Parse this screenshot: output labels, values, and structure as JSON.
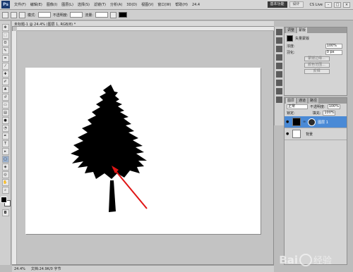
{
  "menubar": {
    "logo": "Ps",
    "items": [
      "文件(F)",
      "编辑(E)",
      "图像(I)",
      "图层(L)",
      "选择(S)",
      "滤镜(T)",
      "分析(A)",
      "3D(D)",
      "视图(V)",
      "窗口(W)",
      "帮助(H)"
    ],
    "zoom": "24.4",
    "workspace_button": "基本功能",
    "design_button": "设计",
    "cslive": "CS Live"
  },
  "optbar": {
    "mode_label": "模式:",
    "opacity_label": "不透明度:",
    "flow_label": "流量:"
  },
  "document": {
    "tab_title": "未标题-1 @ 24.4% (图层 1, RGB/8) *",
    "status_zoom": "24.4%",
    "status_info": "文档:24.9K/0 字节"
  },
  "adjust_panel": {
    "tabs": [
      "调整",
      "蒙版"
    ],
    "title": "矢量蒙版",
    "density_label": "浓度:",
    "density_value": "100%",
    "feather_label": "羽化:",
    "feather_value": "0 px",
    "buttons": [
      "蒙版边缘...",
      "颜色范围...",
      "反相"
    ]
  },
  "layers_panel": {
    "tabs": [
      "图层",
      "通道",
      "路径"
    ],
    "blend_mode": "正常",
    "opacity_label": "不透明度:",
    "opacity_value": "100%",
    "lock_label": "锁定:",
    "fill_label": "填充:",
    "fill_value": "100%",
    "layers": [
      {
        "name": "图层 1",
        "selected": true
      },
      {
        "name": "背景",
        "selected": false
      }
    ]
  },
  "watermark": {
    "text": "Bai",
    "text2": "经验"
  },
  "colors": {
    "selection": "#4a8ad6",
    "arrow": "#e01515",
    "tree": "#000000"
  }
}
